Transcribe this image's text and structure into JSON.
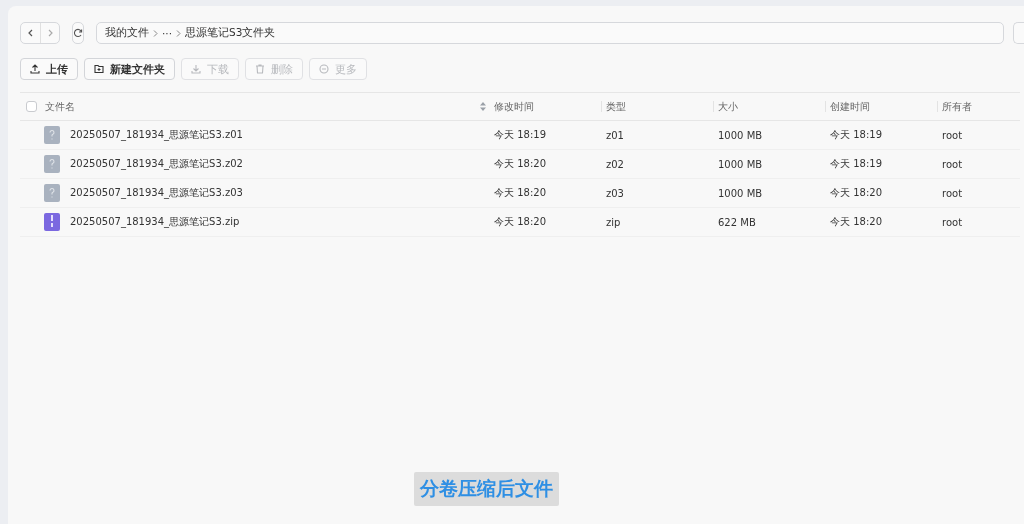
{
  "breadcrumb": [
    "我的文件",
    "···",
    "思源笔记S3文件夹"
  ],
  "toolbar": [
    {
      "label": "上传",
      "kind": "upload",
      "disabled": false
    },
    {
      "label": "新建文件夹",
      "kind": "folder",
      "disabled": false
    },
    {
      "label": "下载",
      "kind": "download",
      "disabled": true
    },
    {
      "label": "删除",
      "kind": "delete",
      "disabled": true
    },
    {
      "label": "更多",
      "kind": "more",
      "disabled": true
    }
  ],
  "table": {
    "select_all": {
      "checked": false
    },
    "columns": [
      "文件名",
      "修改时间",
      "类型",
      "大小",
      "创建时间",
      "所有者"
    ],
    "rows": [
      {
        "kind": "unknown",
        "name": "20250507_181934_思源笔记S3.z01",
        "modified": "今天 18:19",
        "type": "z01",
        "size": "1000 MB",
        "created": "今天 18:19",
        "owner": "root"
      },
      {
        "kind": "unknown",
        "name": "20250507_181934_思源笔记S3.z02",
        "modified": "今天 18:20",
        "type": "z02",
        "size": "1000 MB",
        "created": "今天 18:19",
        "owner": "root"
      },
      {
        "kind": "unknown",
        "name": "20250507_181934_思源笔记S3.z03",
        "modified": "今天 18:20",
        "type": "z03",
        "size": "1000 MB",
        "created": "今天 18:20",
        "owner": "root"
      },
      {
        "kind": "zip",
        "name": "20250507_181934_思源笔记S3.zip",
        "modified": "今天 18:20",
        "type": "zip",
        "size": "622 MB",
        "created": "今天 18:20",
        "owner": "root"
      }
    ]
  },
  "caption": "分卷压缩后文件"
}
